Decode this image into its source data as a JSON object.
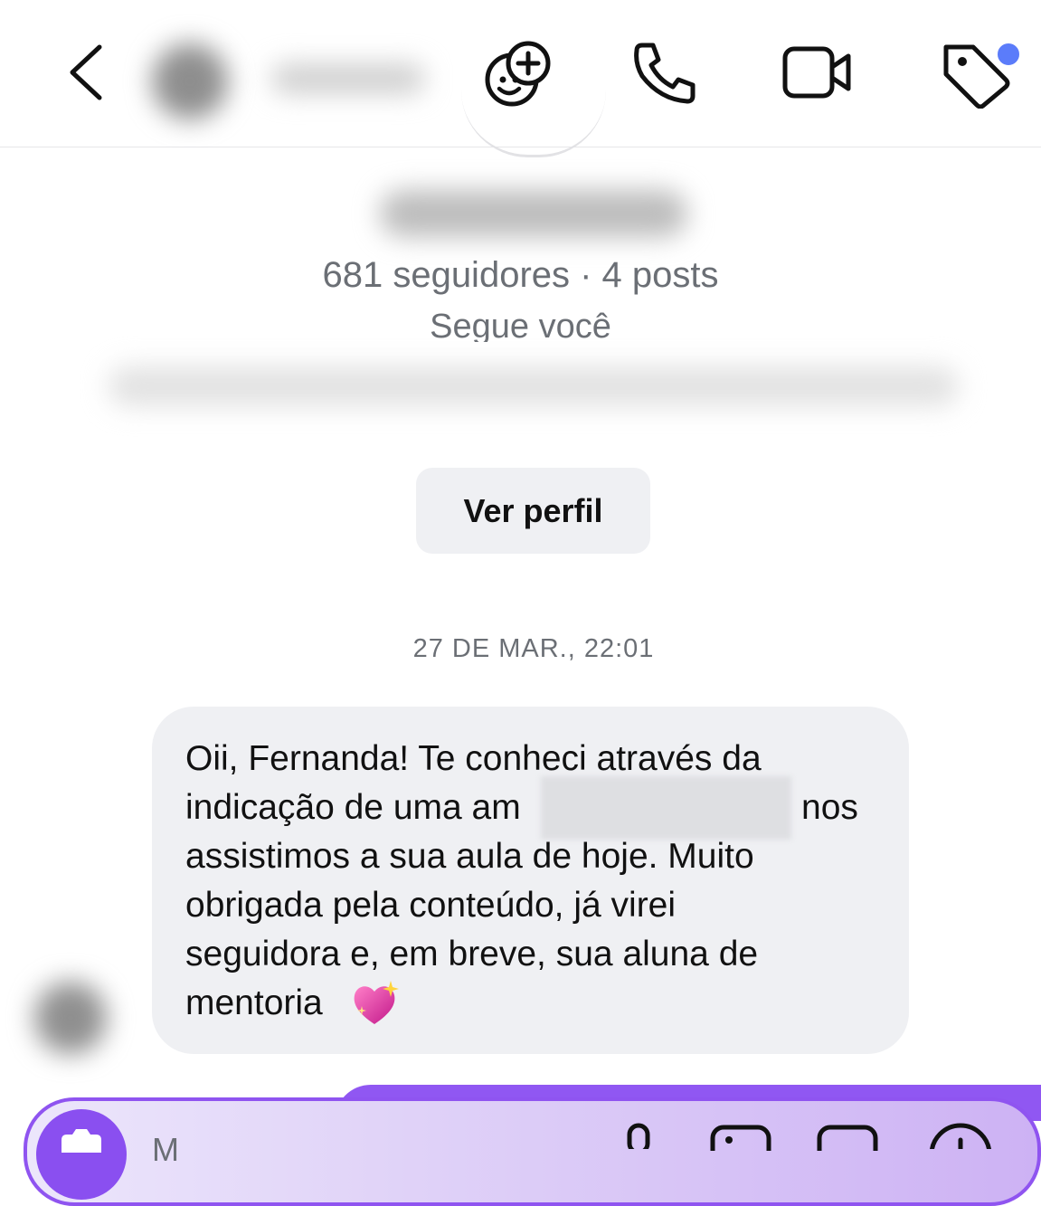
{
  "header": {
    "contact_name": "",
    "icons": [
      "back-chevron-icon",
      "add-sticker-icon",
      "phone-icon",
      "video-icon",
      "tag-icon"
    ],
    "notification_dot_color": "#5b7cfa"
  },
  "profile": {
    "stats": "681 seguidores · 4 posts",
    "follows_you": "Segue você",
    "view_profile_label": "Ver perfil"
  },
  "thread": {
    "timestamp": "27 DE MAR., 22:01",
    "message_lines": [
      "Oii, Fernanda! Te conheci através da",
      "indicação de uma am",
      "nos",
      "assistimos a sua aula de hoje. Muito",
      "obrigada pela conteúdo, já virei",
      "seguidora e, em breve, sua aluna de",
      "mentoria"
    ],
    "bubble_color": "#eff0f3"
  },
  "composer": {
    "placeholder": "M",
    "accent_color": "#8a4ff0"
  }
}
